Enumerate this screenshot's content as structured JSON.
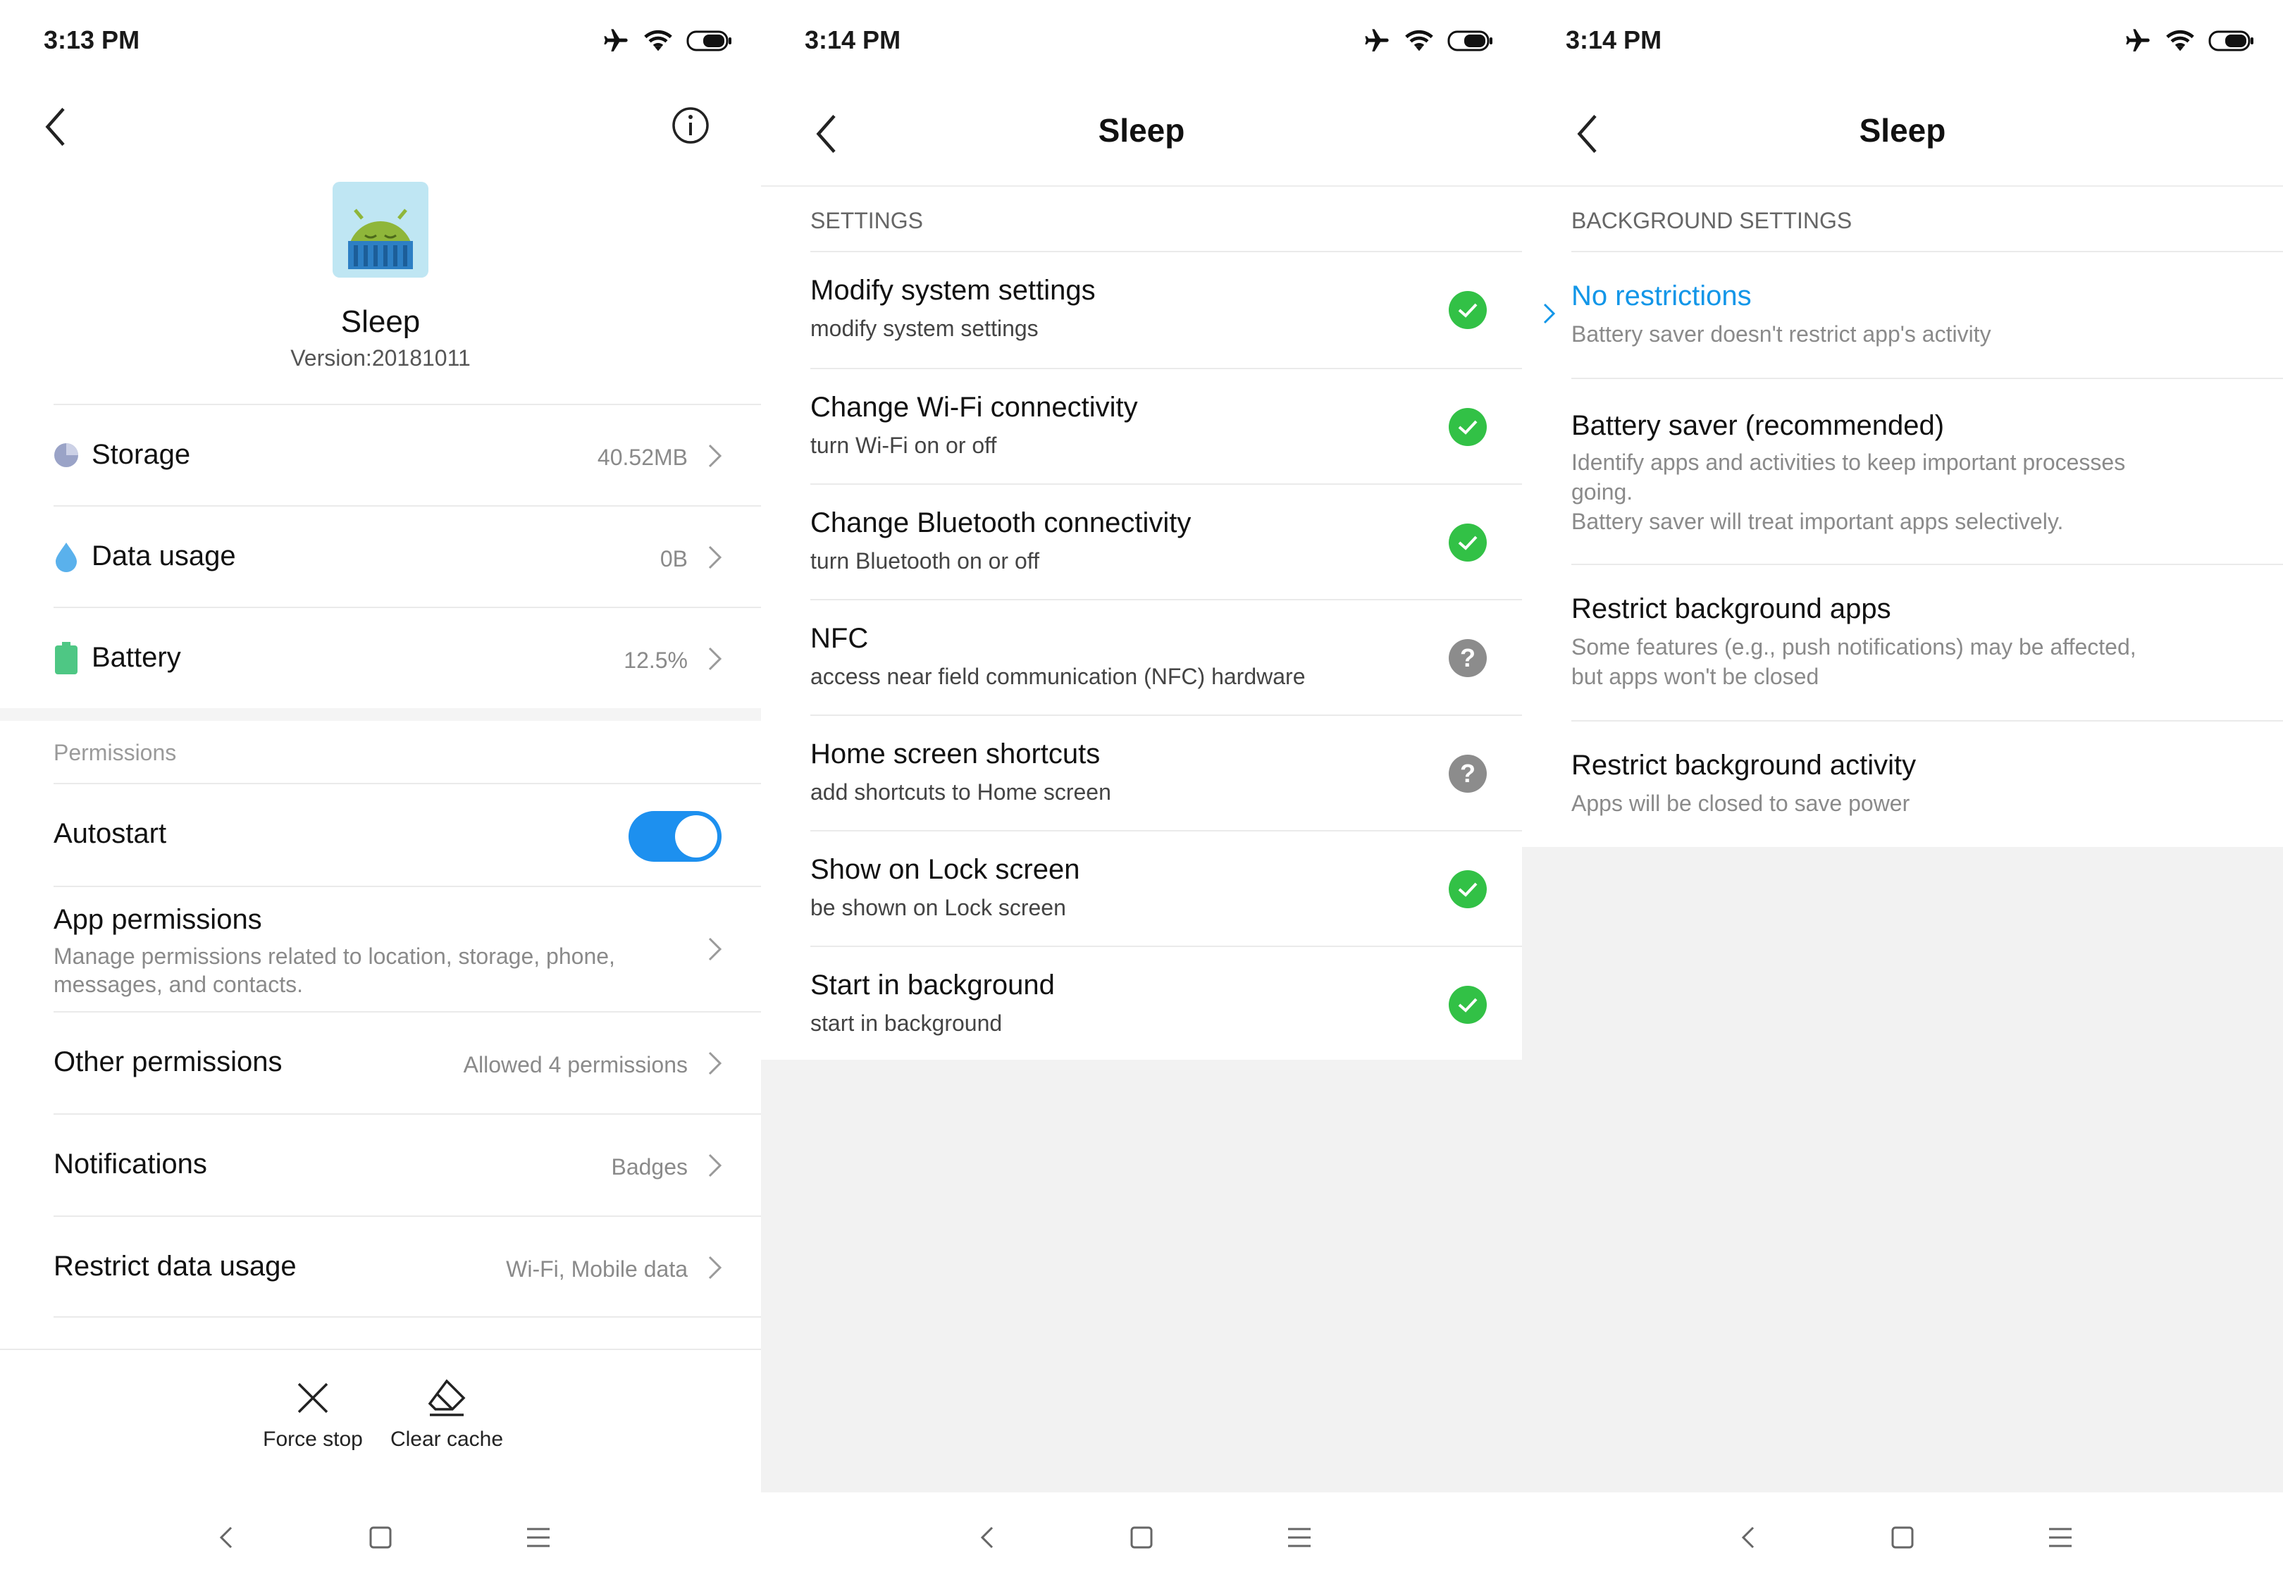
{
  "colors": {
    "accent": "#1296e8",
    "toggle_on": "#1d90ef",
    "ok_green": "#32c146",
    "unknown_grey": "#8c8c8c"
  },
  "panel1": {
    "status": {
      "time": "3:13 PM"
    },
    "app": {
      "name": "Sleep",
      "version": "Version:20181011"
    },
    "rows": [
      {
        "label": "Storage",
        "value": "40.52MB",
        "icon": "pie-chart-icon"
      },
      {
        "label": "Data usage",
        "value": "0B",
        "icon": "water-drop-icon"
      },
      {
        "label": "Battery",
        "value": "12.5%",
        "icon": "battery-icon"
      }
    ],
    "permissions_header": "Permissions",
    "autostart": {
      "label": "Autostart",
      "enabled": true
    },
    "app_permissions": {
      "label": "App permissions",
      "sub": "Manage permissions related to location, storage, phone, messages, and contacts."
    },
    "other_permissions": {
      "label": "Other permissions",
      "value": "Allowed 4 permissions"
    },
    "notifications": {
      "label": "Notifications",
      "value": "Badges"
    },
    "restrict_data": {
      "label": "Restrict data usage",
      "value": "Wi-Fi, Mobile data"
    },
    "actions": {
      "force_stop": "Force stop",
      "clear_cache": "Clear cache"
    }
  },
  "panel2": {
    "status": {
      "time": "3:14 PM"
    },
    "title": "Sleep",
    "section": "SETTINGS",
    "items": [
      {
        "label": "Modify system settings",
        "sub": "modify system settings",
        "state": "allowed"
      },
      {
        "label": "Change Wi-Fi connectivity",
        "sub": "turn Wi-Fi on or off",
        "state": "allowed"
      },
      {
        "label": "Change Bluetooth connectivity",
        "sub": "turn Bluetooth on or off",
        "state": "allowed"
      },
      {
        "label": "NFC",
        "sub": "access near field communication (NFC) hardware",
        "state": "ask"
      },
      {
        "label": "Home screen shortcuts",
        "sub": "add shortcuts to Home screen",
        "state": "ask"
      },
      {
        "label": "Show on Lock screen",
        "sub": "be shown on Lock screen",
        "state": "allowed"
      },
      {
        "label": "Start in background",
        "sub": "start in background",
        "state": "allowed"
      }
    ]
  },
  "panel3": {
    "status": {
      "time": "3:14 PM"
    },
    "title": "Sleep",
    "section": "BACKGROUND SETTINGS",
    "options": [
      {
        "label": "No restrictions",
        "sub1": "Battery saver doesn't restrict app's activity",
        "selected": true
      },
      {
        "label": "Battery saver (recommended)",
        "sub1": "Identify apps and activities to keep important processes",
        "sub2": "going.",
        "sub3": "Battery saver will treat important apps selectively."
      },
      {
        "label": "Restrict background apps",
        "sub1": "Some features (e.g., push notifications) may be affected,",
        "sub2": "but apps won't be closed"
      },
      {
        "label": "Restrict background activity",
        "sub1": "Apps will be closed to save power"
      }
    ]
  }
}
